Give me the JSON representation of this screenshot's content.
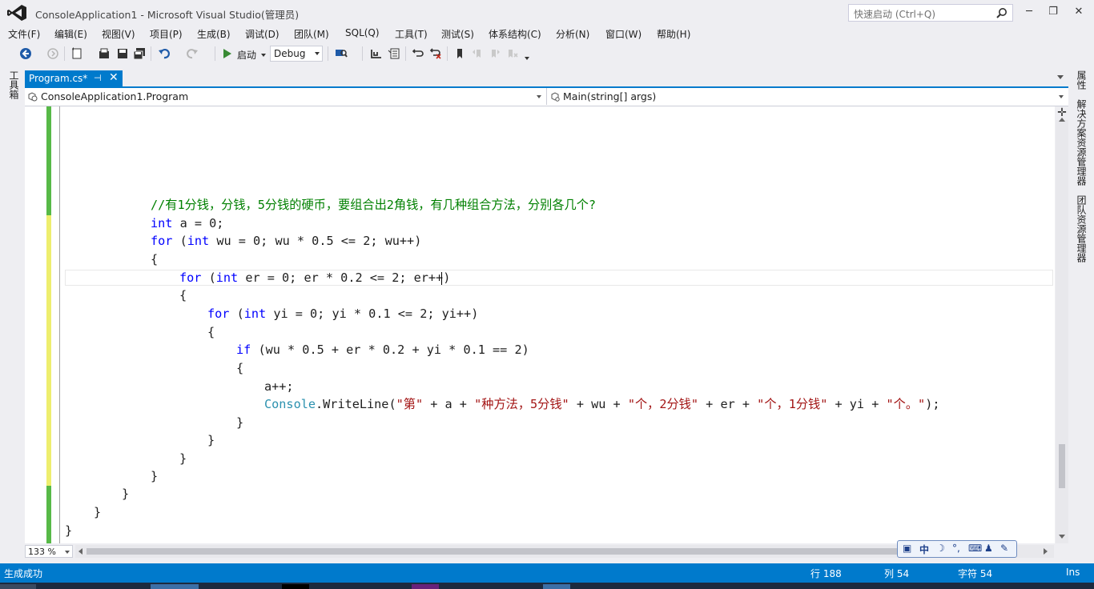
{
  "window": {
    "title": "ConsoleApplication1 - Microsoft Visual Studio(管理员)",
    "quick_launch_placeholder": "快速启动 (Ctrl+Q)",
    "minimize": "─",
    "maximize": "❐",
    "close": "✕"
  },
  "menu": [
    "文件(F)",
    "编辑(E)",
    "视图(V)",
    "项目(P)",
    "生成(B)",
    "调试(D)",
    "团队(M)",
    "SQL(Q)",
    "工具(T)",
    "测试(S)",
    "体系结构(C)",
    "分析(N)",
    "窗口(W)",
    "帮助(H)"
  ],
  "toolbar": {
    "start_label": "启动",
    "configuration": "Debug"
  },
  "left_panel": {
    "toolbox_label": "工具箱"
  },
  "right_panel": {
    "properties": "属性",
    "solution_explorer": "解决方案资源管理器",
    "team_explorer": "团队资源管理器"
  },
  "document_tab": {
    "label": "Program.cs*",
    "pin": "⊣",
    "close": "✕"
  },
  "navigation": {
    "type_dropdown": "ConsoleApplication1.Program",
    "member_dropdown": "Main(string[] args)"
  },
  "code": {
    "comment": "//有1分钱，分钱，5分钱的硬币，要组合出2角钱，有几种组合方法，分别各几个?",
    "l2_kw": "int",
    "l2_rest": " a = 0;",
    "l3_kw": "for",
    "l3_a": " (",
    "l3_kw2": "int",
    "l3_rest": " wu = 0; wu * 0.5 <= 2; wu++)",
    "brace_open": "{",
    "brace_close": "}",
    "l5_kw": "for",
    "l5_a": " (",
    "l5_kw2": "int",
    "l5_rest": " er = 0; er * 0.2 <= 2; er++)",
    "l7_kw": "for",
    "l7_a": " (",
    "l7_kw2": "int",
    "l7_rest": " yi = 0; yi * 0.1 <= 2; yi++)",
    "l9_kw": "if",
    "l9_rest": " (wu * 0.5 + er * 0.2 + yi * 0.1 == 2)",
    "l11": "a++;",
    "l12_type": "Console",
    "l12_a": ".WriteLine(",
    "l12_s1": "\"第\"",
    "l12_b": " + a + ",
    "l12_s2": "\"种方法，5分钱\"",
    "l12_c": " + wu + ",
    "l12_s3": "\"个，2分钱\"",
    "l12_d": " + er + ",
    "l12_s4": "\"个，1分钱\"",
    "l12_e": " + yi + ",
    "l12_s5": "\"个。\"",
    "l12_f": ");"
  },
  "editor": {
    "zoom": "133 %"
  },
  "ime": {
    "mode": "中"
  },
  "status": {
    "message": "生成成功",
    "row": "行 188",
    "col": "列 54",
    "char": "字符 54",
    "ins": "Ins"
  },
  "colors": {
    "accent": "#007acc",
    "keyword": "#0000ff",
    "comment": "#008000",
    "string": "#a31515",
    "type": "#2b91af",
    "saved_change": "#57b947",
    "unsaved_change": "#eeee6e"
  }
}
